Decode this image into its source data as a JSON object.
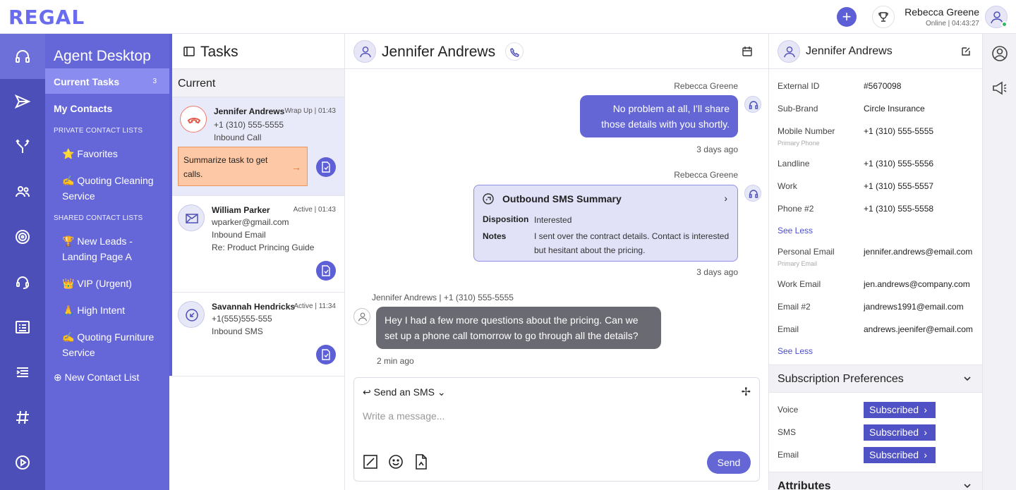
{
  "app": {
    "logo": "REGAL"
  },
  "topbar": {
    "user_name": "Rebecca Greene",
    "user_status": "Online | 04:43:27",
    "plus": "+"
  },
  "sidebar": {
    "title": "Agent Desktop",
    "current_tasks": {
      "label": "Current Tasks",
      "count": "3"
    },
    "my_contacts": "My Contacts",
    "private_header": "PRIVATE CONTACT LISTS",
    "private_lists": [
      {
        "emoji": "⭐",
        "label": "Favorites"
      },
      {
        "emoji": "✍",
        "label": "Quoting Cleaning Service"
      }
    ],
    "shared_header": "SHARED CONTACT LISTS",
    "shared_lists": [
      {
        "emoji": "🏆",
        "label": "New Leads - Landing Page A"
      },
      {
        "emoji": "👑",
        "label": "VIP (Urgent)"
      },
      {
        "emoji": "🙏",
        "label": "High Intent"
      },
      {
        "emoji": "✍",
        "label": "Quoting Furniture Service"
      }
    ],
    "new_list": "New Contact List"
  },
  "tasks": {
    "title": "Tasks",
    "section": "Current",
    "items": [
      {
        "name": "Jennifer Andrews",
        "status": "Wrap Up | 01:43",
        "line1": "+1 (310) 555-5555",
        "line2": "Inbound Call",
        "line3": "",
        "summary": "Summarize task to get calls."
      },
      {
        "name": "William Parker",
        "status": "Active | 01:43",
        "line1": "wparker@gmail.com",
        "line2": "Inbound Email",
        "line3": "Re: Product Princing Guide"
      },
      {
        "name": "Savannah Hendricks",
        "status": "Active | 11:34",
        "line1": "+1(555)555-555",
        "line2": "Inbound SMS",
        "line3": ""
      }
    ]
  },
  "conversation": {
    "contact_name": "Jennifer Andrews",
    "messages": [
      {
        "sender": "Rebecca Greene",
        "text": "No problem at all, I'll share those details with you shortly.",
        "time": "3 days ago"
      },
      {
        "sender": "Rebecca Greene",
        "card_title": "Outbound SMS Summary",
        "disposition_label": "Disposition",
        "disposition": "Interested",
        "notes_label": "Notes",
        "notes": "I sent over the contract details. Contact is interested but hesitant about the pricing.",
        "time": "3 days ago"
      },
      {
        "sender_meta": "Jennifer Andrews  |  +1 (310) 555-5555",
        "text": "Hey I had a few more questions about the pricing. Can we set up a phone call tomorrow to go through all the details?",
        "time": "2 min ago"
      }
    ],
    "composer": {
      "mode": "Send an SMS",
      "placeholder": "Write a message...",
      "send": "Send"
    }
  },
  "details": {
    "name": "Jennifer Andrews",
    "fields": [
      {
        "label": "External ID",
        "value": "#5670098"
      },
      {
        "label": "Sub-Brand",
        "value": "Circle Insurance"
      },
      {
        "label": "Mobile Number",
        "sub": "Primary Phone",
        "value": "+1 (310) 555-5555"
      },
      {
        "label": "Landline",
        "value": "+1 (310) 555-5556"
      },
      {
        "label": "Work",
        "value": "+1 (310) 555-5557"
      },
      {
        "label": "Phone #2",
        "value": "+1 (310) 555-5558"
      },
      {
        "label": "Personal Email",
        "sub": "Primary Email",
        "value": "jennifer.andrews@email.com"
      },
      {
        "label": "Work Email",
        "value": "jen.andrews@company.com"
      },
      {
        "label": "Email #2",
        "value": "jandrews1991@email.com"
      },
      {
        "label": "Email",
        "value": "andrews.jeenifer@email.com"
      }
    ],
    "see_less": "See Less",
    "subscription_title": "Subscription Preferences",
    "subscriptions": [
      {
        "channel": "Voice",
        "status": "Subscribed"
      },
      {
        "channel": "SMS",
        "status": "Subscribed"
      },
      {
        "channel": "Email",
        "status": "Subscribed"
      }
    ],
    "attributes_title": "Attributes"
  },
  "colors": {
    "rail": "#4d4fb9",
    "sidebar": "#6567d8",
    "accent": "#5c5fd6",
    "summary_bg": "#fdc8a6",
    "incoming": "#6a6a72"
  }
}
